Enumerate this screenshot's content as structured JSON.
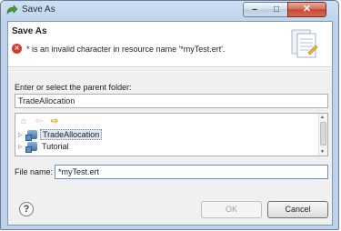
{
  "window": {
    "title": "Save As",
    "minimize_glyph": "–",
    "maximize_glyph": "□",
    "close_glyph": "✕"
  },
  "header": {
    "title": "Save As",
    "error_glyph": "✕",
    "error_message": "* is an invalid character in resource name '*myTest.ert'."
  },
  "folder": {
    "label": "Enter or select the parent folder:",
    "value": "TradeAllocation"
  },
  "tree": {
    "items": [
      {
        "label": "TradeAllocation",
        "selected": true
      },
      {
        "label": "Tutorial",
        "selected": false
      }
    ]
  },
  "file": {
    "label": "File name:",
    "value": "*myTest.ert"
  },
  "buttons": {
    "help_glyph": "?",
    "ok": "OK",
    "cancel": "Cancel"
  },
  "colors": {
    "error": "#d9382a",
    "frame": "#bcd2ec",
    "body": "#f0f0f0"
  }
}
